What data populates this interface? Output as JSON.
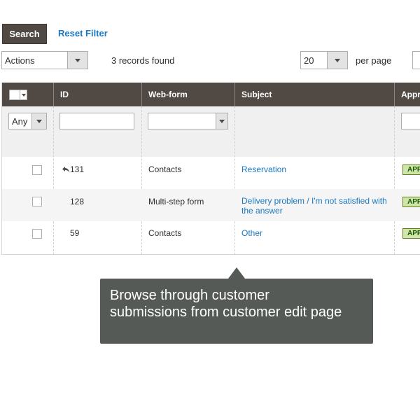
{
  "toolbar": {
    "search_label": "Search",
    "reset_label": "Reset Filter",
    "actions_value": "Actions",
    "records_found": "3 records found",
    "per_page_value": "20",
    "per_page_label": "per page"
  },
  "grid": {
    "columns": [
      "ID",
      "Web-form",
      "Subject",
      "Appro"
    ],
    "filters": {
      "select_value": "Any"
    },
    "rows": [
      {
        "id": "131",
        "webform": "Contacts",
        "subject_1": "Reservation",
        "subject_2": "",
        "status": "APP"
      },
      {
        "id": "128",
        "webform": "Multi-step form",
        "subject_1": "Delivery problem / I'm not satisfied with",
        "subject_2": "the answer",
        "status": "APP"
      },
      {
        "id": "59",
        "webform": "Contacts",
        "subject_1": "Other",
        "subject_2": "",
        "status": "APP"
      }
    ]
  },
  "tooltip": {
    "line1": "Browse through customer",
    "line2": "submissions from customer edit page"
  },
  "colors": {
    "accent_dark": "#514943",
    "link": "#1979c3",
    "tooltip_bg": "#565a57",
    "badge_bg": "#d0e5a9"
  },
  "icons": {
    "reply": "reply-arrow-icon",
    "dropdown": "chevron-down-icon"
  }
}
